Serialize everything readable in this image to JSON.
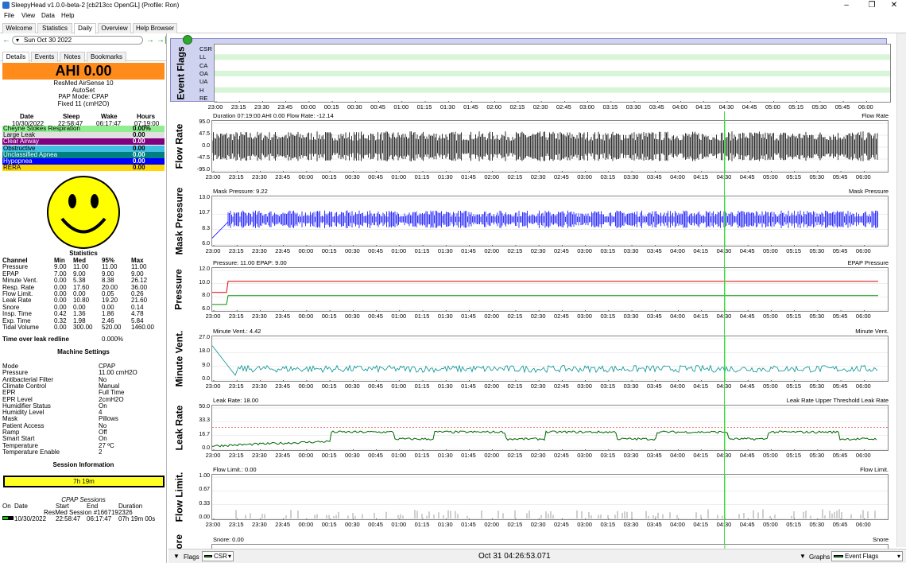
{
  "window": {
    "title": "SleepyHead v1.0.0-beta-2 [cb213cc OpenGL] (Profile: Ron)"
  },
  "menu": [
    "File",
    "View",
    "Data",
    "Help"
  ],
  "tabs": [
    "Welcome",
    "Statistics",
    "Daily",
    "Overview",
    "Help Browser"
  ],
  "date_nav": {
    "date": "Sun Oct 30 2022"
  },
  "subtabs": [
    "Details",
    "Events",
    "Notes",
    "Bookmarks"
  ],
  "ahi": {
    "label": "AHI 0.00",
    "color": "#ff8c1a"
  },
  "machine": {
    "model": "ResMed AirSense 10",
    "mode_line": "AutoSet",
    "pap_mode": "PAP Mode: CPAP",
    "pressure": "Fixed 11 (cmH2O)"
  },
  "sleep_times": {
    "headers": [
      "Date",
      "Sleep",
      "Wake",
      "Hours"
    ],
    "values": [
      "10/30/2022",
      "22:58:47",
      "06:17:47",
      "07:19:00"
    ]
  },
  "event_rows": [
    {
      "label": "Cheyne Stokes Respiration",
      "value": "0.00%",
      "color": "#90ee90",
      "text": "#000"
    },
    {
      "label": "Large Leak",
      "value": "0.00",
      "color": "#e0e0e0",
      "text": "#000"
    },
    {
      "label": "Clear Airway",
      "value": "0.00",
      "color": "#800080",
      "text": "#fff"
    },
    {
      "label": "Obstructive",
      "value": "0.00",
      "color": "#40c0e0",
      "text": "#000"
    },
    {
      "label": "Unclassified Apnea",
      "value": "0.00",
      "color": "#008080",
      "text": "#fff"
    },
    {
      "label": "Hypopnea",
      "value": "0.00",
      "color": "#0000ff",
      "text": "#fff"
    },
    {
      "label": "RERA",
      "value": "0.00",
      "color": "#ffd700",
      "text": "#000"
    }
  ],
  "statistics": {
    "title": "Statistics",
    "headers": [
      "Channel",
      "Min",
      "Med",
      "95%",
      "Max"
    ],
    "rows": [
      [
        "Pressure",
        "9.00",
        "11.00",
        "11.00",
        "11.00"
      ],
      [
        "EPAP",
        "7.00",
        "9.00",
        "9.00",
        "9.00"
      ],
      [
        "Minute Vent.",
        "0.00",
        "5.38",
        "8.38",
        "26.12"
      ],
      [
        "Resp. Rate",
        "0.00",
        "17.60",
        "20.00",
        "36.00"
      ],
      [
        "Flow Limit.",
        "0.00",
        "0.00",
        "0.05",
        "0.26"
      ],
      [
        "Leak Rate",
        "0.00",
        "10.80",
        "19.20",
        "21.60"
      ],
      [
        "Snore",
        "0.00",
        "0.00",
        "0.00",
        "0.14"
      ],
      [
        "Insp. Time",
        "0.42",
        "1.36",
        "1.86",
        "4.78"
      ],
      [
        "Exp. Time",
        "0.32",
        "1.98",
        "2.46",
        "5.84"
      ],
      [
        "Tidal Volume",
        "0.00",
        "300.00",
        "520.00",
        "1460.00"
      ]
    ]
  },
  "leak_redline": {
    "label": "Time over leak redline",
    "value": "0.000%"
  },
  "machine_settings": {
    "title": "Machine Settings",
    "rows": [
      [
        "Mode",
        "CPAP"
      ],
      [
        "Pressure",
        "11.00 cmH2O"
      ],
      [
        "Antibacterial Filter",
        "No"
      ],
      [
        "Climate Control",
        "Manual"
      ],
      [
        "EPR",
        "Full Time"
      ],
      [
        "EPR Level",
        "2cmH2O"
      ],
      [
        "Humidifier Status",
        "On"
      ],
      [
        "Humidity Level",
        "4"
      ],
      [
        "Mask",
        "Pillows"
      ],
      [
        "Patient Access",
        "No"
      ],
      [
        "Ramp",
        "Off"
      ],
      [
        "Smart Start",
        "On"
      ],
      [
        "Temperature",
        "27 ºC"
      ],
      [
        "Temperature Enable",
        "2"
      ]
    ]
  },
  "session": {
    "title": "Session Information",
    "bar": "7h 19m",
    "cpap_title": "CPAP Sessions",
    "headers": [
      "On",
      "Date",
      "Start",
      "End",
      "Duration"
    ],
    "subheader": "ResMed Session #1667192326",
    "row": [
      "10/30/2022",
      "22:58:47",
      "06:17:47",
      "07h 19m 00s"
    ]
  },
  "x_ticks": [
    "23:00",
    "23:15",
    "23:30",
    "23:45",
    "00:00",
    "00:15",
    "00:30",
    "00:45",
    "01:00",
    "01:15",
    "01:30",
    "01:45",
    "02:00",
    "02:15",
    "02:30",
    "02:45",
    "03:00",
    "03:15",
    "03:30",
    "03:45",
    "04:00",
    "04:15",
    "04:30",
    "04:45",
    "05:00",
    "05:15",
    "05:30",
    "05:45",
    "06:00"
  ],
  "graphs": [
    {
      "name": "Event Flags",
      "header": "",
      "legend": "",
      "yticks": [
        "CSR",
        "LL",
        "CA",
        "OA",
        "UA",
        "H",
        "RE"
      ],
      "color": "#000"
    },
    {
      "name": "Flow Rate",
      "header": "Duration 07:19:00 AHI 0.00 Flow Rate: -12.14",
      "legend": "Flow Rate",
      "yticks": [
        "95.0",
        "47.5",
        "0.0",
        "-47.5",
        "-95.0"
      ],
      "color": "#000000"
    },
    {
      "name": "Mask Pressure",
      "header": "Mask Pressure: 9.22",
      "legend": "Mask Pressure",
      "yticks": [
        "13.0",
        "10.7",
        "8.3",
        "6.0"
      ],
      "color": "#0000ff"
    },
    {
      "name": "Pressure",
      "header": "Pressure: 11.00 EPAP: 9.00",
      "legend": "EPAP Pressure",
      "yticks": [
        "12.0",
        "10.0",
        "8.0",
        "6.0"
      ],
      "color": "#e00000"
    },
    {
      "name": "Minute Vent.",
      "header": "Minute Vent.: 4.42",
      "legend": "Minute Vent.",
      "yticks": [
        "27.0",
        "18.0",
        "9.0",
        "0.0"
      ],
      "color": "#009090"
    },
    {
      "name": "Leak Rate",
      "header": "Leak Rate: 18.00",
      "legend": "Leak Rate Upper Threshold Leak Rate",
      "yticks": [
        "50.0",
        "33.3",
        "16.7",
        "0.0"
      ],
      "color": "#006600"
    },
    {
      "name": "Flow Limit.",
      "header": "Flow Limit.: 0.00",
      "legend": "Flow Limit.",
      "yticks": [
        "1.00",
        "0.67",
        "0.33",
        "0.00"
      ],
      "color": "#888888"
    },
    {
      "name": "Snore",
      "header": "Snore: 0.00",
      "legend": "Snore",
      "yticks": [],
      "color": "#000"
    }
  ],
  "cursor_time": "Oct 31 04:26:53.071",
  "bottom": {
    "flags": "Flags",
    "csr": "CSR",
    "graphs": "Graphs",
    "eventflags": "Event Flags"
  }
}
